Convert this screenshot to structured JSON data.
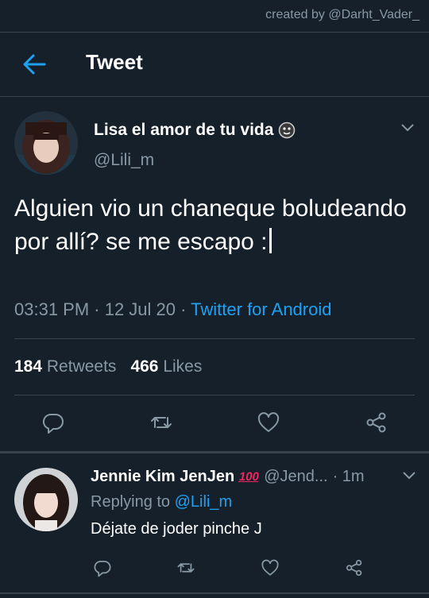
{
  "watermark": "created by @Darht_Vader_",
  "header": {
    "title": "Tweet"
  },
  "tweet": {
    "author_name": "Lisa el amor de tu vida",
    "handle": "@Lili_m",
    "text": "Alguien vio un chaneque boludeando por allí? se me escapo :",
    "time": "03:31 PM · 12 Jul 20 · ",
    "source": "Twitter for Android",
    "retweets_count": "184",
    "retweets_label": "Retweets",
    "likes_count": "466",
    "likes_label": "Likes"
  },
  "reply": {
    "author_name": "Jennie Kim JenJen",
    "badge": "100",
    "handle": "@Jend...",
    "time": "· 1m",
    "replying_prefix": "Replying to",
    "replying_to": "@Lili_m",
    "text": "Déjate de joder pinche J"
  },
  "colors": {
    "background": "#15202b",
    "accent": "#1da1f2",
    "secondary_text": "#8899a6",
    "divider": "#38444d"
  },
  "icons": [
    "back-arrow-icon",
    "smiley-face-icon",
    "chevron-down-icon",
    "reply-icon",
    "retweet-icon",
    "like-icon",
    "share-icon",
    "hundred-points-icon"
  ]
}
